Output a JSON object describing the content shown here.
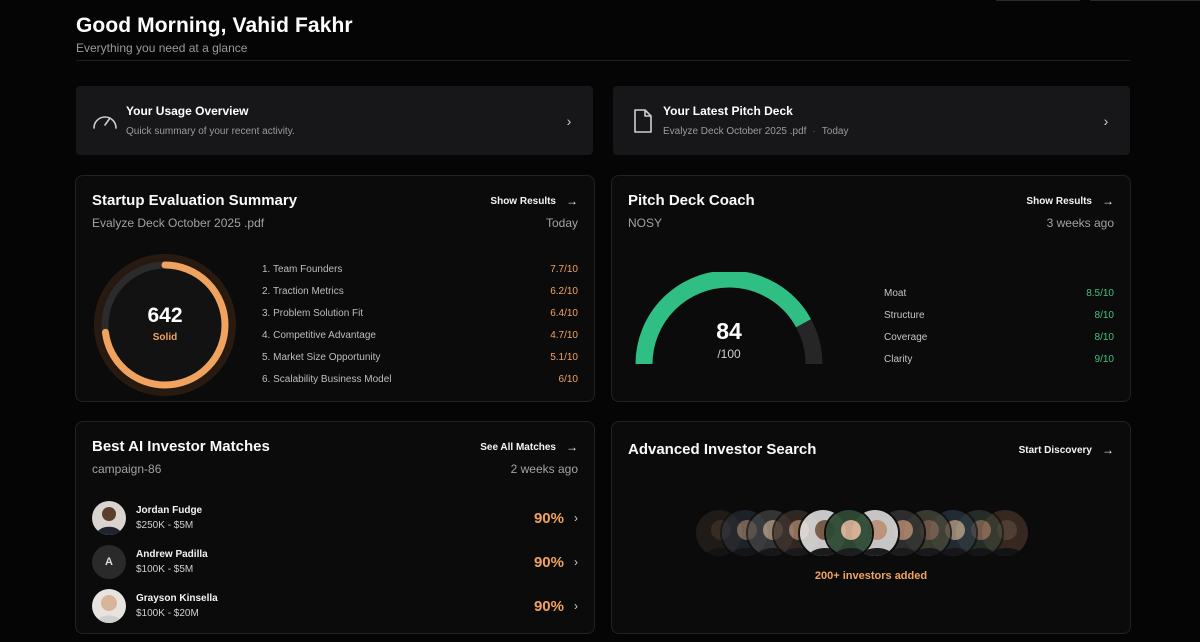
{
  "header": {
    "greeting": "Good Morning, Vahid Fakhr",
    "subtitle": "Everything you need at a glance"
  },
  "banners": {
    "usage": {
      "icon": "speedometer-icon",
      "title": "Your Usage Overview",
      "subtitle": "Quick summary of your recent activity."
    },
    "pitch": {
      "icon": "document-icon",
      "title": "Your Latest Pitch Deck",
      "file": "Evalyze Deck October 2025 .pdf",
      "date": "Today"
    }
  },
  "evaluation": {
    "title": "Startup Evaluation Summary",
    "action": "Show Results",
    "file": "Evalyze Deck October 2025 .pdf",
    "date": "Today",
    "score": "642",
    "score_label": "Solid",
    "score_fraction": 0.73,
    "metrics": [
      {
        "label": "1. Team Founders",
        "value": "7.7/10"
      },
      {
        "label": "2. Traction Metrics",
        "value": "6.2/10"
      },
      {
        "label": "3. Problem Solution Fit",
        "value": "6.4/10"
      },
      {
        "label": "4. Competitive Advantage",
        "value": "4.7/10"
      },
      {
        "label": "5. Market Size Opportunity",
        "value": "5.1/10"
      },
      {
        "label": "6. Scalability Business Model",
        "value": "6/10"
      }
    ]
  },
  "coach": {
    "title": "Pitch Deck Coach",
    "action": "Show Results",
    "name": "NOSY",
    "date": "3 weeks ago",
    "score": "84",
    "score_suffix": "/100",
    "score_fraction": 0.84,
    "metrics": [
      {
        "label": "Moat",
        "value": "8.5/10"
      },
      {
        "label": "Structure",
        "value": "8/10"
      },
      {
        "label": "Coverage",
        "value": "8/10"
      },
      {
        "label": "Clarity",
        "value": "9/10"
      }
    ]
  },
  "matches": {
    "title": "Best AI Investor Matches",
    "action": "See All Matches",
    "campaign": "campaign-86",
    "date": "2 weeks ago",
    "investors": [
      {
        "name": "Jordan Fudge",
        "range": "$250K - $5M",
        "pct": "90%",
        "avatar": "photo"
      },
      {
        "name": "Andrew Padilla",
        "range": "$100K - $5M",
        "pct": "90%",
        "avatar": "initial",
        "initial": "A"
      },
      {
        "name": "Grayson Kinsella",
        "range": "$100K - $20M",
        "pct": "90%",
        "avatar": "photo"
      }
    ]
  },
  "search": {
    "title": "Advanced Investor Search",
    "action": "Start Discovery",
    "added": "200+ investors added"
  },
  "colors": {
    "accent_orange": "#f0a35f",
    "accent_green": "#2fbf84",
    "card_bg": "#0b0b0c",
    "page_bg": "#050505"
  }
}
